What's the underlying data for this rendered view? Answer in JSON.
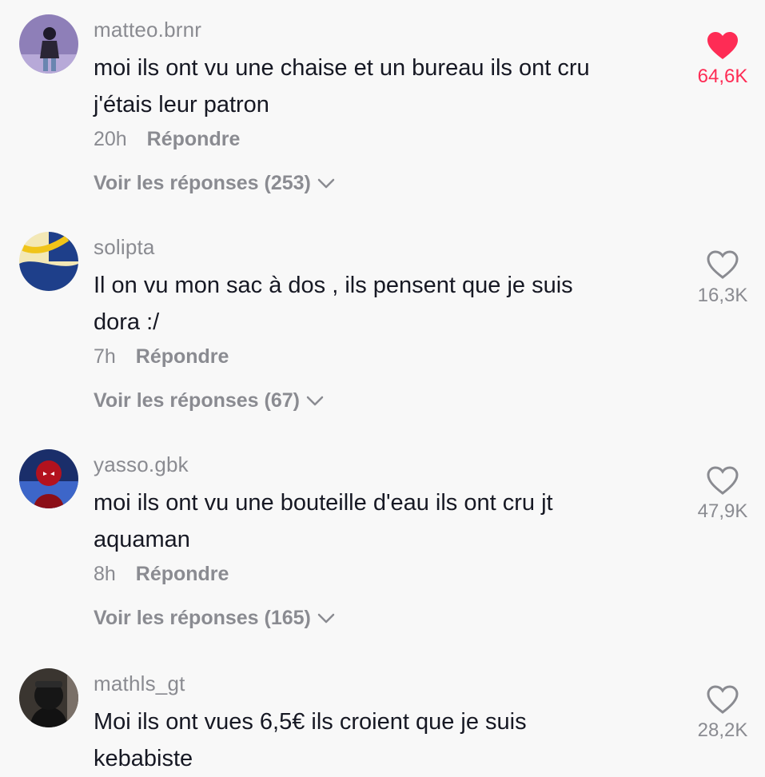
{
  "comments": [
    {
      "username": "matteo.brnr",
      "text_line1": "moi ils ont vu une chaise et un bureau ils ont cru",
      "text_line2": "j'étais leur patron",
      "time": "20h",
      "reply_label": "Répondre",
      "view_replies": "Voir les réponses (253)",
      "likes": "64,6K",
      "liked": true
    },
    {
      "username": "solipta",
      "text_line1": "Il on vu mon sac à dos , ils pensent que je suis",
      "text_line2": "dora :/",
      "time": "7h",
      "reply_label": "Répondre",
      "view_replies": "Voir les réponses (67)",
      "likes": "16,3K",
      "liked": false
    },
    {
      "username": "yasso.gbk",
      "text_line1": "moi ils ont vu une bouteille d'eau ils ont cru jt",
      "text_line2": "aquaman",
      "time": "8h",
      "reply_label": "Répondre",
      "view_replies": "Voir les réponses (165)",
      "likes": "47,9K",
      "liked": false
    },
    {
      "username": "mathls_gt",
      "text_line1": "Moi ils ont vues 6,5€ ils croient que je suis",
      "text_line2": "kebabiste",
      "likes": "28,2K",
      "liked": false
    }
  ],
  "colors": {
    "liked": "#fe2c55",
    "muted": "#8a8b91",
    "text": "#161823",
    "background": "#f8f8f8"
  },
  "icons": {
    "like_filled": "heart-filled-icon",
    "like_outline": "heart-outline-icon",
    "expand": "chevron-down-icon"
  }
}
